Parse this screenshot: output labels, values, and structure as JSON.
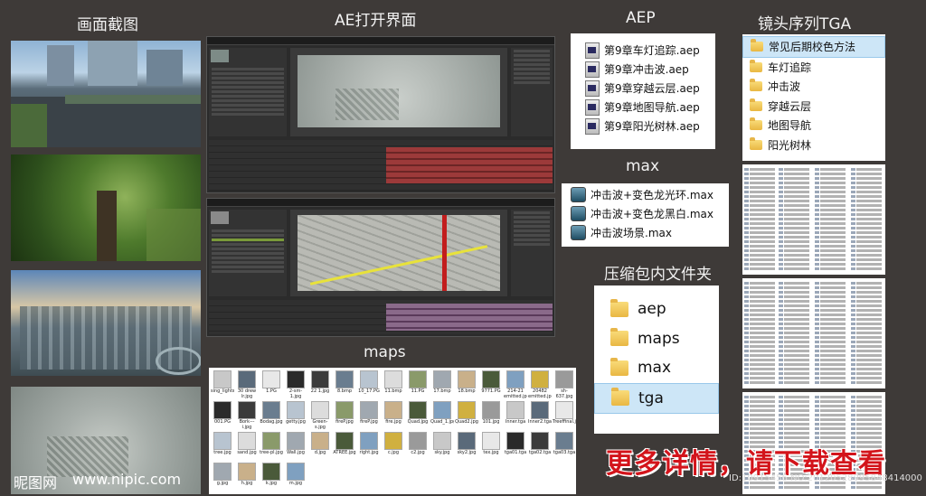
{
  "headers": {
    "screenshots": "画面截图",
    "ae_open": "AE打开界面",
    "aep": "AEP",
    "tga_seq": "镜头序列TGA",
    "max": "max",
    "zip_files": "压缩包内文件夹",
    "maps": "maps"
  },
  "aep_files": [
    "第9章车灯追踪.aep",
    "第9章冲击波.aep",
    "第9章穿越云层.aep",
    "第9章地图导航.aep",
    "第9章阳光树林.aep"
  ],
  "max_files": [
    "冲击波+变色龙光环.max",
    "冲击波+变色龙黑白.max",
    "冲击波场景.max"
  ],
  "tga_folders": [
    "常见后期校色方法",
    "车灯追踪",
    "冲击波",
    "穿越云层",
    "地图导航",
    "阳光树林"
  ],
  "zip_folders": [
    "aep",
    "maps",
    "max",
    "tga"
  ],
  "maps_row1": [
    "sing_lights.jpg",
    "30 drew lr.jpg",
    "1.PG",
    "2-sm-1.jpg",
    "22 1.jpg",
    "8.bmp",
    "10_17.PG",
    "11.bmp",
    "11.PG",
    "17.bmp",
    "18.bmp",
    "9771.PG",
    "214-21 emitted.jpg",
    "20482 emitted.jpg",
    "sh-637.jpg"
  ],
  "maps_row2": [
    "001.PG",
    "Bork---i.jpg",
    "Bodag.jpg",
    "getty.jpg",
    "Green-s.jpg",
    "fireP.jpg",
    "fireP.jpg",
    "fire.jpg",
    "Quad.jpg",
    "Quad_1.jpg",
    "Quad2.jpg",
    "101.jpg",
    "Inner.tga",
    "Inner2.tga",
    "Treeffinal.jpg"
  ],
  "maps_row3": [
    "tree.jpg",
    "sand.jpg",
    "tree-pl.jpg",
    "Wall.jpg",
    "d.jpg",
    "ATREE.jpg",
    "right.jpg",
    "c.jpg",
    "c2.jpg",
    "sky.jpg",
    "sky2.jpg",
    "tex.jpg",
    "tga01.tga",
    "tga02.tga",
    "tga03.tga"
  ],
  "maps_row4": [
    "g.jpg",
    "h.jpg",
    "k.jpg",
    "m.jpg"
  ],
  "promo": "更多详情，请下载查看",
  "watermark": {
    "site": "昵图网",
    "url": "www.nipic.com"
  },
  "id_text": "ID:10915456 NO:20120528095848414000"
}
